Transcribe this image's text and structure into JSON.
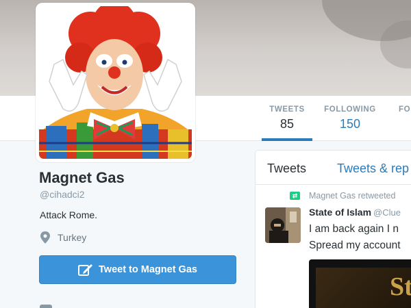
{
  "profile": {
    "name": "Magnet Gas",
    "handle": "@cihadci2",
    "bio": "Attack Rome.",
    "location": "Turkey",
    "tweet_to_label": "Tweet to Magnet Gas"
  },
  "stats": {
    "tweets": {
      "label": "TWEETS",
      "value": "85"
    },
    "following": {
      "label": "FOLLOWING",
      "value": "150"
    },
    "followers": {
      "label": "FO"
    }
  },
  "timeline": {
    "tabs": {
      "tweets": "Tweets",
      "replies": "Tweets & rep"
    },
    "retweet_context": "Magnet Gas retweeted",
    "tweet": {
      "author": "State of Islam",
      "author_handle": "@Clue",
      "lines": [
        "I am back again I n",
        "Spread my account"
      ],
      "media_text": "St"
    }
  },
  "colors": {
    "accent": "#3b94d9",
    "link": "#2b7bb9",
    "muted": "#8899a6",
    "retweet_green": "#19cf86"
  },
  "icons": {
    "location": "map-pin-icon",
    "compose": "compose-icon",
    "retweet": "retweet-icon"
  }
}
